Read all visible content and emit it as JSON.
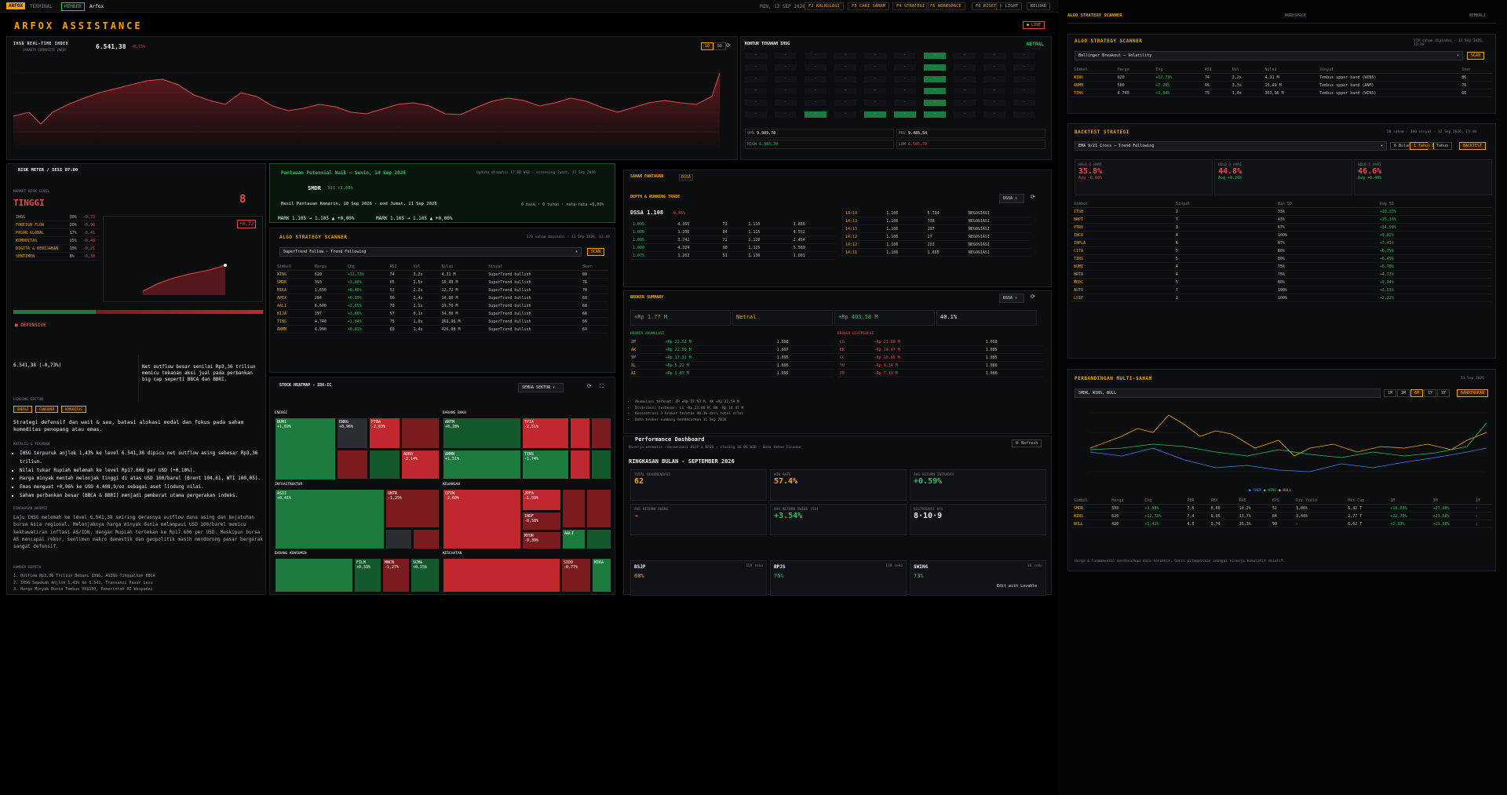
{
  "topbar": {
    "logo": "ARFOX",
    "terminal": "TERMINAL",
    "member": "MEMBER",
    "user": "Arfox",
    "date": "MIN, 13 SEP 2026",
    "f2": "F2 KALKULASI",
    "f3": "F3 CARI SAHAM",
    "f4": "F4 STRATEGI",
    "f5": "F5 WORKSPACE",
    "f6": "F6 RISET",
    "light": "LIGHT",
    "logout": "KELUAR"
  },
  "title": "ARFOX ASSISTANCE",
  "live": "LIVE",
  "ihsg": {
    "label": "IHSG REAL-TIME INDEX",
    "sub": "JAKARTA COMPOSITE INDEX",
    "value": "6.541,38",
    "change": "-0,73%"
  },
  "heatmap_ihsg": {
    "title": "KONTUR TEKANAN IHSG",
    "status": "NETRAL",
    "f1": "9.989,70",
    "f2": "9.485,54",
    "f3": "6.383,70",
    "f4": "6.565,70"
  },
  "risk": {
    "title": "RISK METER / SESI 07:00",
    "level_label": "MARKET RISK LEVEL",
    "level": "TINGGI",
    "score": "8",
    "delta": "+0,72",
    "sectors": [
      {
        "n": "IHSG",
        "w": "30%",
        "c": "-0,73"
      },
      {
        "n": "FOREIGN FLOW",
        "w": "20%",
        "c": "-0,96"
      },
      {
        "n": "PASAR GLOBAL",
        "w": "17%",
        "c": "-0,41"
      },
      {
        "n": "KOMODITAS",
        "w": "15%",
        "c": "-0,48"
      },
      {
        "n": "DIGITA & KEBIJAKAN",
        "w": "10%",
        "c": "-0,21"
      },
      {
        "n": "SENTIMEN",
        "w": "8%",
        "c": "-0,38"
      }
    ],
    "defensive": "DEFENSIVE",
    "ihsg_val": "6.541,38 (-0,73%)",
    "foreign": "Net outflow besar senilai Rp3,36 triliun memicu tekanan aksi jual pada perbankan big cap seperti BBCA dan BBRI.",
    "leading_label": "LEADING SECTOR",
    "tags": [
      "ENERGI",
      "CONSUMER",
      "KOMODITAS"
    ],
    "strategy": "Strategi defensif dan wait & see, batasi alokasi modal dan fokus pada saham komoditas penopang atau emas.",
    "bullets_label": "KATALIS & TEKANAN",
    "bullets": [
      "IHSG terpuruk anjlok 1,43% ke level 6.541,38 dipicu net outflow asing sebesar Rp3,36 triliun.",
      "Nilai tukar Rupiah melemah ke level Rp17.606 per USD (+0,10%).",
      "Harga minyak mentah melonjak tinggi di atas USD 100/barel (Brent 104,61, WTI 100,05).",
      "Emas menguat +0,96% ke USD 4.408,9/oz sebagai aset lindung nilai.",
      "Saham perbankan besar (BBCA & BBRI) menjadi pemberat utama pergerakan indeks."
    ],
    "summary_label": "RINGKASAN NARASI",
    "summary": "Laju IHSG melemah ke level 6.541,38 seiring derasnya outflow dana asing dan kejatuhan bursa Asia regional. Melonjaknya harga minyak dunia melampaui USD 100/barel memicu kekhawatiran inflasi AS/IDN, dengan Rupiah tertekan ke Rp17.606 per USD. Meskipun bursa AS mencapai rekor, sentimen makro domestik dan geopolitik masih mendorong pasar bergerak sangat defensif.",
    "sources_label": "SUMBER BERITA",
    "sources": [
      "1. Outflow Rp3,36 Triliun Bebani IHSG, ASING Tinggalkan BBCA",
      "2. IHSG Sepekan Anjlok 1,43% ke 6.541, Transaksi Pasar Lesu",
      "3. Harga Minyak Dunia Tembus US$100, Pemerintah RI Waspadai"
    ]
  },
  "watch": {
    "title": "Pantauan Potensial Naik — Senin, 14 Sep 2026",
    "update": "Update otomatis 17:00 WIB - screening Jumat, 11 Sep 2026",
    "ticker": "SMDR",
    "price": "393",
    "chg": "+3,08%",
    "hist": "Hasil Pantauan Kemarin, 10 Sep 2026 - eod Jumat, 11 Sep 2026",
    "stat": "0 naik · 0 turun · rata-rata +0,00%",
    "mark1": "MARK 1.105 → 1.105 ▲ +0,00%",
    "mark2": "MARK 1.105 → 1.105 ▲ +0,00%"
  },
  "algo1": {
    "title": "ALGO STRATEGY SCANNER",
    "meta": "178 saham dipindai · 13 Sep 2026, 13:49",
    "strategy": "SuperTrend Follow — Trend Following",
    "scan": "SCAN",
    "cols": [
      "Simbol",
      "Harga",
      "Chg",
      "RSI",
      "Vol",
      "Nilai",
      "Sinyal",
      "Skor"
    ],
    "rows": [
      [
        "WINS",
        "620",
        "+12,73%",
        "74",
        "3,2x",
        "4,31 M",
        "SuperTrend bullish",
        "80"
      ],
      [
        "SMDR",
        "393",
        "+3,08%",
        "65",
        "2,5x",
        "10,49 M",
        "SuperTrend bullish",
        "76"
      ],
      [
        "MIKA",
        "1.650",
        "+0,46%",
        "52",
        "2,2x",
        "12,72 M",
        "SuperTrend bullish",
        "70"
      ],
      [
        "APEX",
        "204",
        "+0,99%",
        "66",
        "2,4x",
        "14,80 M",
        "SuperTrend bullish",
        "68"
      ],
      [
        "AALI",
        "6.600",
        "+2,65%",
        "70",
        "1,1x",
        "19,79 M",
        "SuperTrend bullish",
        "68"
      ],
      [
        "KIJA",
        "197",
        "+3,66%",
        "57",
        "0,1x",
        "34,00 M",
        "SuperTrend bullish",
        "66"
      ],
      [
        "TINS",
        "4.740",
        "+1,84%",
        "75",
        "1,0x",
        "363,96 M",
        "SuperTrend bullish",
        "66"
      ],
      [
        "ANMM",
        "4.990",
        "+0,81%",
        "69",
        "1,4x",
        "426,08 M",
        "SuperTrend bullish",
        "64"
      ]
    ]
  },
  "stockheat": {
    "title": "STOCK HEATMAP - IDX-IC",
    "filter": "SEMUA SEKTOR",
    "s1": "ENERGI",
    "s1c": "-0,6%",
    "s2": "BARANG BAKU",
    "s2c": "-0,4%",
    "s3": "INFRASTRUKTUR",
    "s3c": "-0,2%",
    "s4": "KEUANGAN",
    "s4c": "-1,1%",
    "s5": "BARANG KONSUMEN",
    "s5c": "",
    "s6": "KESEHATAN",
    "s6c": "",
    "t": [
      "BUMI",
      "ENRG",
      "PTBA",
      "ANTM",
      "TPIA",
      "TINS",
      "ADRO",
      "ASII",
      "UNTR",
      "CPIN",
      "JPFA",
      "INDF",
      "MYOR",
      "AALI",
      "FILM",
      "MNCN",
      "SCMA",
      "SIDO",
      "MIKA",
      "BULL",
      "AMMN"
    ],
    "tc": [
      "+1,69%",
      "+0,96%",
      "-2,03%",
      "+0,28%",
      "-2,51%",
      "-1,74%",
      "-2,14%",
      "+0,41%",
      "-1,25%",
      "-2,60%",
      "-1,50%",
      "-0,58%",
      "-0,39%",
      "+2,65%",
      "+0,33%",
      "-1,27%",
      "+0,15%",
      "-0,77%",
      "+0,46%",
      "+1,42%",
      "+1,51%"
    ]
  },
  "depth": {
    "section": "SAHAM PANTAUAN",
    "ticker": "DSSA",
    "title": "DEPTH & RUNNING TRADE",
    "stock": "DSSA 1.108",
    "chg": "-0,45%",
    "sel": "DSSA",
    "bids": [
      [
        "1.095",
        "4.355",
        "73"
      ],
      [
        "1.090",
        "1.206",
        "84"
      ],
      [
        "1.085",
        "3.742",
        "71"
      ],
      [
        "1.080",
        "4.324",
        "90"
      ],
      [
        "1.075",
        "1.262",
        "51"
      ]
    ],
    "asks": [
      [
        "1.110",
        "3.856"
      ],
      [
        "1.115",
        "4.552"
      ],
      [
        "1.120",
        "2.454"
      ],
      [
        "1.125",
        "5.589"
      ],
      [
        "1.130",
        "1.001"
      ]
    ],
    "trades": [
      [
        "14:14",
        "1.106",
        "5.794",
        "NEGOSIASI"
      ],
      [
        "14:13",
        "1.106",
        "738",
        "NEGOSIASI"
      ],
      [
        "14:13",
        "1.106",
        "197",
        "NEGOSIASI"
      ],
      [
        "14:12",
        "1.106",
        "27",
        "NEGOSIASI"
      ],
      [
        "14:12",
        "1.106",
        "223",
        "NEGOSIASI"
      ],
      [
        "14:11",
        "1.106",
        "1.665",
        "NEGOSIASI"
      ]
    ]
  },
  "broker": {
    "title": "BROKER SUMMARY",
    "net": "+Rp 1.77 M",
    "bias": "Netral",
    "total": "+Rp 403.58 M",
    "top3": "40.1%",
    "buy_label": "BROKER AKUMULASI",
    "sell_label": "BROKER DISTRIBUSI",
    "buys": [
      [
        "ZP",
        "+Rp 22.53 M",
        "1.098"
      ],
      [
        "AK",
        "+Rp 22.59 M",
        "1.097"
      ],
      [
        "YP",
        "+Rp 17.31 M",
        "1.095"
      ],
      [
        "XL",
        "+Rp 5.22 M",
        "1.096"
      ],
      [
        "AI",
        "+Rp 3.87 M",
        "1.095"
      ]
    ],
    "sells": [
      [
        "LG",
        "-Rp 21.80 M",
        "1.098"
      ],
      [
        "BK",
        "-Rp 14.47 M",
        "1.085"
      ],
      [
        "CC",
        "-Rp 10.85 M",
        "1.085"
      ],
      [
        "YU",
        "-Rp 9.14 M",
        "1.086"
      ],
      [
        "PD",
        "-Rp 7.19 M",
        "1.086"
      ]
    ],
    "notes": [
      "Akumulasi terkuat: ZP +Rp 22.53 M, AK +Rp 22.59 M",
      "Distribusi terbesar: LG -Rp 21.80 M, BK -Rp 14.47 M",
      "Konsentrasi 3 broker teratas 40.1% dari total nilai",
      "Data broker summary berdasarkan 11 Sep 2026"
    ]
  },
  "perf": {
    "title": "Performance Dashboard",
    "sub": "Kinerja otomatis rekomendasi BSJP & BPJS · closing 16:00 WIB · data Yahoo Finance",
    "refresh": "Refresh",
    "ringkas": "RINGKASAN BULAN - SEPTEMBER 2026",
    "k1l": "TOTAL REKOMENDASI",
    "k1": "62",
    "k2l": "WIN RATE",
    "k2": "57.4%",
    "k3l": "AVG RETURN INTRADAY",
    "k3": "+0.59%",
    "k4l": "AVG RETURN SWING",
    "k4": "-",
    "k5l": "AVG RETURN SWING (5D)",
    "k5": "+3.54%",
    "k6l": "DISTRIBUSI W/L",
    "k6": "8·10·9",
    "c1": "BSJP",
    "c1n": "156 reko",
    "c1v": "60%",
    "c2": "BPJS",
    "c2n": "118 reko",
    "c2v": "76%",
    "c3": "SWING",
    "c3n": "28 reko",
    "c3v": "73%",
    "lovable": "Edit with Lovable"
  },
  "right": {
    "tab1": "ALGO STRATEGY SCANNER",
    "tab2": "WORKSPACE",
    "tab3": "KEMBALI"
  },
  "algo2": {
    "title": "ALGO STRATEGY SCANNER",
    "meta": "178 saham dipindai · 13 Sep 2026, 13:49",
    "strategy": "Bollinger Breakout — Volatility",
    "scan": "SCAN",
    "cols": [
      "Simbol",
      "Harga",
      "Chg",
      "RSI",
      "Vol",
      "Nilai",
      "Sinyal",
      "Skor"
    ],
    "rows": [
      [
        "WINS",
        "620",
        "+12,73%",
        "74",
        "3,2x",
        "4,31 M",
        "Tembus upper band (WINS)",
        "86"
      ],
      [
        "ANMM",
        "580",
        "+7,28%",
        "65",
        "3,3x",
        "15,49 M",
        "Tembus upper band (ANM)",
        "76"
      ],
      [
        "TINS",
        "4.740",
        "+1,84%",
        "75",
        "1,0x",
        "363,96 M",
        "Tembus upper band (WINS)",
        "66"
      ]
    ]
  },
  "backtest": {
    "title": "BACKTEST STRATEGI",
    "meta": "30 saham · 300 sinyal · 12 Sep 2026, 13:49",
    "strategy": "EMA 9/21 Cross — Trend Following",
    "p1": "6 Bulan",
    "p2": "1 Tahun",
    "p3": "3 Tahun",
    "run": "BACKTEST",
    "h1l": "HOLD 1 HARI",
    "h1": "35.8%",
    "h1a": "Avg -0.00%",
    "h2l": "HOLD 3 HARI",
    "h2": "44.8%",
    "h2a": "Avg +0.26%",
    "h3l": "HOLD 5 HARI",
    "h3": "46.6%",
    "h3a": "Avg +0.40%",
    "cols": [
      "Simbol",
      "Sinyal",
      "Win 5D",
      "Avg 5D"
    ],
    "rows": [
      [
        "ITSH",
        "2",
        "33%",
        "+10,33%"
      ],
      [
        "BRPT",
        "7",
        "43%",
        "+15,10%"
      ],
      [
        "PTRO",
        "3",
        "67%",
        "+14,99%"
      ],
      [
        "INCO",
        "4",
        "100%",
        "+9,82%"
      ],
      [
        "INPLA",
        "6",
        "67%",
        "+7,41%"
      ],
      [
        "CITA",
        "5",
        "80%",
        "+6,79%"
      ],
      [
        "TINS",
        "5",
        "80%",
        "+6,49%"
      ],
      [
        "BUMI",
        "4",
        "75%",
        "+5,70%"
      ],
      [
        "HRTA",
        "4",
        "75%",
        "+4,73%"
      ],
      [
        "MEDC",
        "5",
        "60%",
        "+3,94%"
      ],
      [
        "AUTO",
        "7",
        "100%",
        "+3,53%"
      ],
      [
        "LSIP",
        "2",
        "100%",
        "+2,22%"
      ]
    ]
  },
  "multi": {
    "title": "PERBANDINGAN MULTI-SAHAM",
    "date": "13 Sep 2026",
    "input": "SMDR, WINS, BULL",
    "ranges": [
      "1M",
      "3M",
      "6M",
      "1Y",
      "3Y"
    ],
    "compare": "BANDINGKAN",
    "legend": [
      "SMDR",
      "WINS",
      "BULL"
    ],
    "cols": [
      "Simbol",
      "Harga",
      "Chg",
      "PER",
      "PBV",
      "ROE",
      "EPS",
      "Div Yield",
      "Mkt Cap",
      "1M",
      "3M",
      "1Y"
    ],
    "rows": [
      [
        "SMDR",
        "393",
        "+3,08%",
        "7,5",
        "0,66",
        "10,2%",
        "52",
        "3,06%",
        "6,42 T",
        "+19,03%",
        "+27,00%",
        "-"
      ],
      [
        "WINS",
        "620",
        "+12,73%",
        "7,4",
        "0,95",
        "13,7%",
        "84",
        "3,44%",
        "2,77 T",
        "+22,78%",
        "+23,58%",
        "-"
      ],
      [
        "BULL",
        "420",
        "+1,42%",
        "4,9",
        "3,74",
        "35,3%",
        "90",
        "-",
        "6,62 T",
        "+2,93%",
        "+21,08%",
        "-"
      ]
    ],
    "note": "Harga & fundamental berdasarkan data terakhir. Garis ditampilkan sebagai kinerja kumulatif relatif."
  },
  "colors": {
    "accent": "#f5a300",
    "up": "#22c55e",
    "down": "#e5484d",
    "bg": "#0c0d0f"
  }
}
